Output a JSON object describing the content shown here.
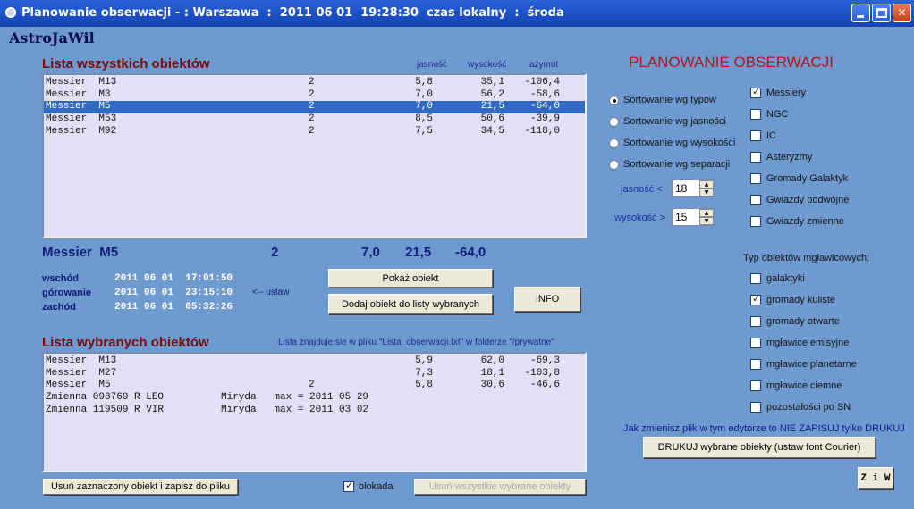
{
  "window": {
    "title": "Planowanie obserwacji - : Warszawa  :  2011 06 01  19:28:30  czas lokalny  :  środa"
  },
  "brand": "AstroJaWil",
  "all_objects": {
    "title": "Lista wszystkich obiektów",
    "columns": {
      "brightness": "jasność",
      "altitude": "wysokość",
      "azimuth": "azymut"
    },
    "rows": [
      {
        "name": "Messier  M13",
        "type": "2",
        "mag": "5,8",
        "alt": "35,1",
        "az": "-106,4",
        "selected": false
      },
      {
        "name": "Messier  M3",
        "type": "2",
        "mag": "7,0",
        "alt": "56,2",
        "az": "-58,6",
        "selected": false
      },
      {
        "name": "Messier  M5",
        "type": "2",
        "mag": "7,0",
        "alt": "21,5",
        "az": "-64,0",
        "selected": true
      },
      {
        "name": "Messier  M53",
        "type": "2",
        "mag": "8,5",
        "alt": "50,6",
        "az": "-39,9",
        "selected": false
      },
      {
        "name": "Messier  M92",
        "type": "2",
        "mag": "7,5",
        "alt": "34,5",
        "az": "-118,0",
        "selected": false
      }
    ]
  },
  "current": {
    "name": "Messier  M5",
    "type": "2",
    "mag": "7,0",
    "alt": "21,5",
    "az": "-64,0",
    "rise_label": "wschód",
    "rise": "2011 06 01  17:01:50",
    "transit_label": "górowanie",
    "transit": "2011 06 01  23:15:10",
    "set_label": "zachód",
    "set": "2011 06 01  05:32:26",
    "hint": "<-- ustaw"
  },
  "buttons": {
    "show": "Pokaż obiekt",
    "add": "Dodaj obiekt do listy wybranych",
    "info": "INFO",
    "remove_selected": "Usuń zaznaczony obiekt i zapisz do pliku",
    "remove_all": "Usuń wszystkie wybrane obiekty",
    "print": "DRUKUJ wybrane obiekty (ustaw font Courier)",
    "ziw": "Z i W"
  },
  "selected_list": {
    "title": "Lista wybranych obiektów",
    "note": "Lista znajduje sie w pliku \"Lista_obserwacji.txt\" w folderze \"/prywatne\"",
    "rows": [
      {
        "name": "Messier  M13",
        "extra": "",
        "type": "",
        "mag": "5,9",
        "alt": "62,0",
        "az": "-69,3"
      },
      {
        "name": "Messier  M27",
        "extra": "",
        "type": "",
        "mag": "7,3",
        "alt": "18,1",
        "az": "-103,8"
      },
      {
        "name": "Messier  M5",
        "extra": "",
        "type": "2",
        "mag": "5,8",
        "alt": "30,6",
        "az": "-46,6"
      },
      {
        "name": "Zmienna 098769 R LEO",
        "extra": "Miryda   max = 2011 05 29",
        "type": "",
        "mag": "",
        "alt": "",
        "az": ""
      },
      {
        "name": "Zmienna 119509 R VIR",
        "extra": "Miryda   max = 2011 03 02",
        "type": "",
        "mag": "",
        "alt": "",
        "az": ""
      }
    ]
  },
  "lock": {
    "label": "blokada",
    "checked": true
  },
  "planning": {
    "title": "PLANOWANIE OBSERWACJI",
    "sort_options": [
      {
        "label": "Sortowanie wg typów",
        "checked": true
      },
      {
        "label": "Sortowanie wg jasności",
        "checked": false
      },
      {
        "label": "Sortowanie wg wysokości",
        "checked": false
      },
      {
        "label": "Sortowanie wg separacji",
        "checked": false
      }
    ],
    "brightness_label": "jasność <",
    "brightness_value": "18",
    "altitude_label": "wysokość >",
    "altitude_value": "15",
    "catalogs": [
      {
        "label": "Messiery",
        "checked": true
      },
      {
        "label": "NGC",
        "checked": false
      },
      {
        "label": "IC",
        "checked": false
      },
      {
        "label": "Asteryzmy",
        "checked": false
      },
      {
        "label": "Gromady Galaktyk",
        "checked": false
      },
      {
        "label": "Gwiazdy podwójne",
        "checked": false
      },
      {
        "label": "Gwiazdy zmienne",
        "checked": false
      }
    ],
    "nebula_title": "Typ obiektów mgławicowych:",
    "nebula_types": [
      {
        "label": "galaktyki",
        "checked": false
      },
      {
        "label": "gromady kuliste",
        "checked": true
      },
      {
        "label": "gromady otwarte",
        "checked": false
      },
      {
        "label": "mgławice emisyjne",
        "checked": false
      },
      {
        "label": "mgławice planetarne",
        "checked": false
      },
      {
        "label": "mgławice ciemne",
        "checked": false
      },
      {
        "label": "pozostałości po SN",
        "checked": false
      }
    ],
    "edit_note": "Jak zmienisz plik w tym edytorze to NIE ZAPISUJ tylko DRUKUJ"
  }
}
